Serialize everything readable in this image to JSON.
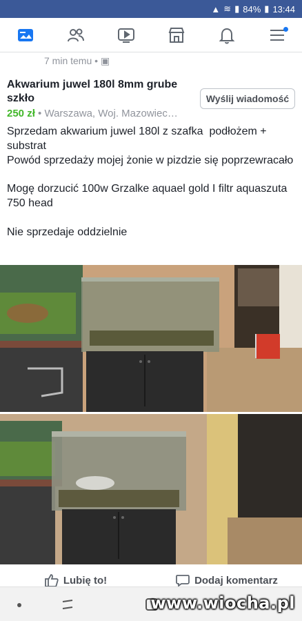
{
  "status_bar": {
    "battery": "84%",
    "time": "13:44"
  },
  "nav": {
    "items": [
      "marketplace-icon",
      "friends-icon",
      "watch-icon",
      "store-icon",
      "notifications-icon",
      "menu-icon"
    ],
    "accent": "#1877f2"
  },
  "post": {
    "time_ago": "7 min temu",
    "title": "Akwarium juwel 180l 8mm grube szkło",
    "price": "250 zł",
    "location": "Warszawa, Woj. Mazowiec…",
    "message_button": "Wyślij wiadomość",
    "description": "Sprzedam akwarium juwel 180l z szafka  podłożem + substrat\nPowód sprzedaży mojej żonie w pizdzie się poprzewracało\n\nMogę dorzucić 100w Grzalke aquael gold I filtr aquaszuta 750 head\n\nNie sprzedaje oddzielnie"
  },
  "actions": {
    "like": "Lubię to!",
    "comment": "Dodaj komentarz"
  },
  "watermark": "www.wiocha.pl"
}
